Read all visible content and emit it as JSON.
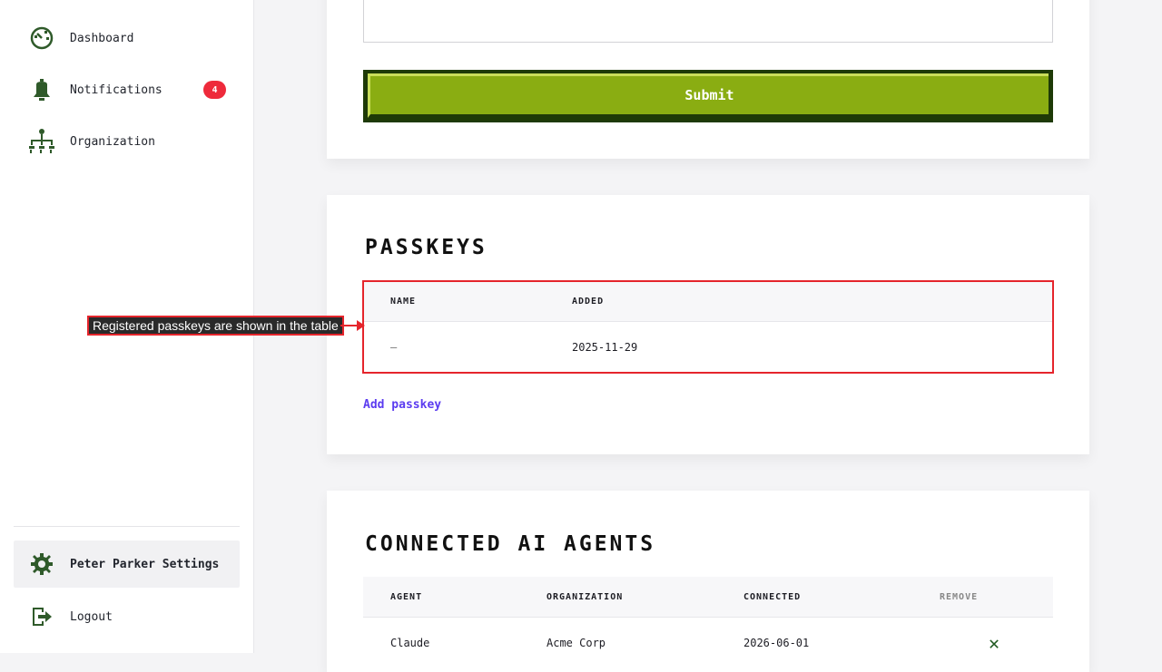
{
  "sidebar": {
    "items": [
      {
        "label": "Dashboard",
        "icon": "dashboard-icon"
      },
      {
        "label": "Notifications",
        "icon": "bell-icon",
        "badge": "4"
      },
      {
        "label": "Organization",
        "icon": "org-chart-icon"
      }
    ],
    "settings_label": "Peter Parker Settings",
    "logout_label": "Logout"
  },
  "form": {
    "submit_label": "Submit"
  },
  "passkeys": {
    "title": "PASSKEYS",
    "columns": [
      "NAME",
      "ADDED"
    ],
    "rows": [
      {
        "name": "–",
        "added": "2025-11-29"
      }
    ],
    "add_label": "Add passkey"
  },
  "agents": {
    "title": "CONNECTED AI AGENTS",
    "columns": [
      "AGENT",
      "ORGANIZATION",
      "CONNECTED",
      "REMOVE"
    ],
    "rows": [
      {
        "agent": "Claude",
        "organization": "Acme Corp",
        "connected": "2026-06-01"
      }
    ]
  },
  "callout": {
    "text": "Registered passkeys are shown in the table"
  },
  "colors": {
    "accent_green": "#8aad12",
    "dark_green": "#1e3a07",
    "badge_red": "#ee2a3b",
    "link_purple": "#5b3cf0",
    "highlight_red": "#e5252c"
  }
}
